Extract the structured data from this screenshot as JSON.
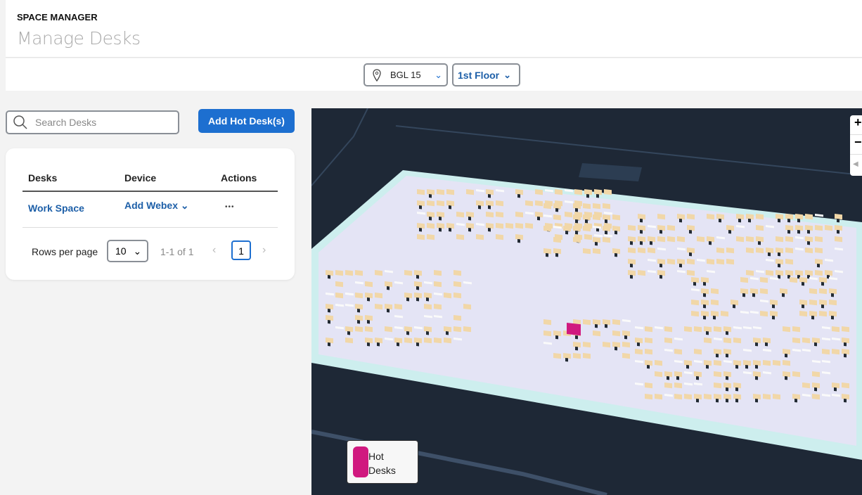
{
  "header": {
    "app_name": "SPACE MANAGER",
    "title": "Manage Desks"
  },
  "filters": {
    "building": "BGL 15",
    "floor": "1st Floor"
  },
  "search": {
    "placeholder": "Search Desks"
  },
  "add_button": "Add Hot Desk(s)",
  "table": {
    "columns": [
      "Desks",
      "Device",
      "Actions"
    ],
    "rows": [
      {
        "desk": "Work Space",
        "device": "Add Webex",
        "actions": "•••"
      }
    ]
  },
  "pagination": {
    "rows_per_page_label": "Rows per page",
    "rows_per_page": "10",
    "range": "1-1 of 1",
    "page": "1"
  },
  "map": {
    "zoom_in": "+",
    "zoom_out": "−",
    "legend": {
      "label": "Hot Desks",
      "color": "#d0197f"
    }
  }
}
